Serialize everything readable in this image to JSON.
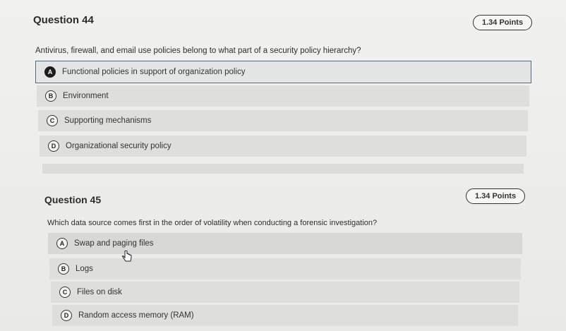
{
  "q44": {
    "title": "Question 44",
    "points": "1.34 Points",
    "prompt": "Antivirus, firewall, and email use policies belong to what part of a security policy hierarchy?",
    "options": [
      {
        "letter": "A",
        "text": "Functional policies in support of organization policy",
        "selected": true
      },
      {
        "letter": "B",
        "text": "Environment",
        "selected": false
      },
      {
        "letter": "C",
        "text": "Supporting mechanisms",
        "selected": false
      },
      {
        "letter": "D",
        "text": "Organizational security policy",
        "selected": false
      }
    ]
  },
  "q45": {
    "title": "Question 45",
    "points": "1.34 Points",
    "prompt": "Which data source comes first in the order of volatility when conducting a forensic investigation?",
    "options": [
      {
        "letter": "A",
        "text": "Swap and paging files",
        "selected": false
      },
      {
        "letter": "B",
        "text": "Logs",
        "selected": false
      },
      {
        "letter": "C",
        "text": "Files on disk",
        "selected": false
      },
      {
        "letter": "D",
        "text": "Random access memory (RAM)",
        "selected": false
      }
    ]
  },
  "colors": {
    "selected_border": "#4a6e86",
    "option_bg": "#dededc"
  },
  "icons": {
    "cursor": "hand-pointer-icon"
  }
}
